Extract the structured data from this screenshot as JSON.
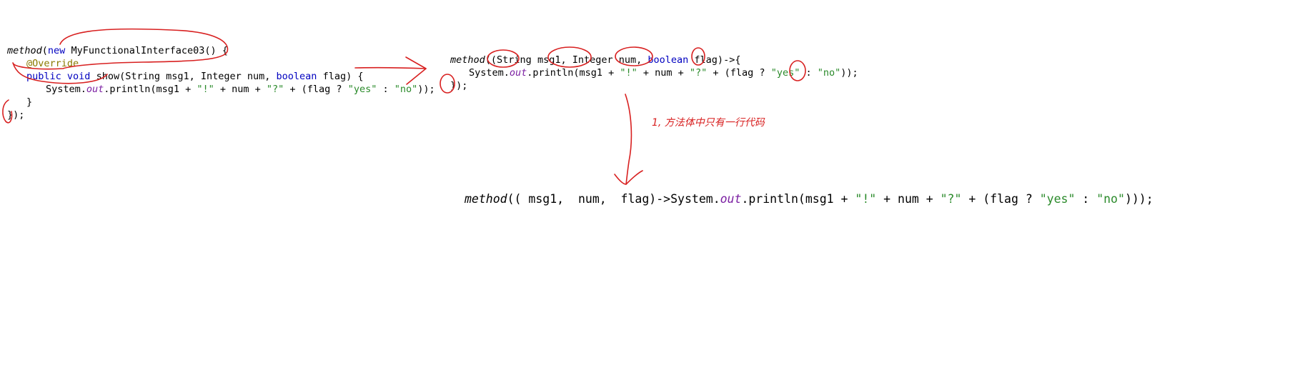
{
  "snippet1": {
    "l1": {
      "a": "method",
      "b": "(",
      "c": "new",
      "d": " MyFunctionalInterface03() {"
    },
    "l2": {
      "a": "@Override"
    },
    "l3": {
      "a": "public",
      "b": " ",
      "c": "void",
      "d": " show(String msg1, Integer num, ",
      "e": "boolean",
      "f": " flag) {"
    },
    "l4": {
      "a": "System.",
      "b": "out",
      "c": ".println(msg1 + ",
      "d": "\"!\"",
      "e": " + num + ",
      "f": "\"?\"",
      "g": " + (flag ? ",
      "h": "\"yes\"",
      "i": " : ",
      "j": "\"no\"",
      "k": "));"
    },
    "l5": {
      "a": "}"
    },
    "l6": {
      "a": "});"
    }
  },
  "snippet2": {
    "l1": {
      "a": "method",
      "b": "((",
      "c": "String",
      "d": " msg1, Integer num, ",
      "e": "boolean",
      "f": " flag)->{"
    },
    "l2": {
      "a": "System.",
      "b": "out",
      "c": ".println(msg1 + ",
      "d": "\"!\"",
      "e": " + num + ",
      "f": "\"?\"",
      "g": " + (flag ? ",
      "h": "\"yes\"",
      "i": " : ",
      "j": "\"no\"",
      "k": "));"
    },
    "l3": {
      "a": "});"
    }
  },
  "snippet3": {
    "l1": {
      "a": "method",
      "b": "(( msg1,  num,  flag)->System.",
      "c": "out",
      "d": ".println(msg1 + ",
      "e": "\"!\"",
      "f": " + num + ",
      "g": "\"?\"",
      "h": " + (flag ? ",
      "i": "\"yes\"",
      "j": " : ",
      "k": "\"no\"",
      "l": ")));"
    }
  },
  "annotation": {
    "note": "1, 方法体中只有一行代码"
  },
  "colors": {
    "keyword": "#0000c0",
    "string": "#2a8a2a",
    "annotation": "#8a7a00",
    "field": "#7b1fa2",
    "ink": "#d82020"
  }
}
